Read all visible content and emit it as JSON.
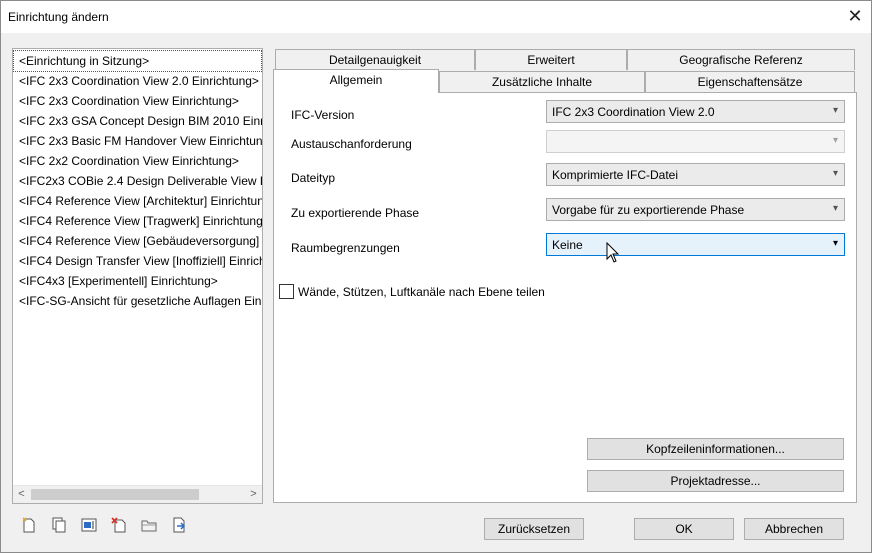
{
  "window": {
    "title": "Einrichtung ändern"
  },
  "setups": [
    "<Einrichtung in Sitzung>",
    "<IFC 2x3 Coordination View 2.0 Einrichtung>",
    "<IFC 2x3 Coordination View Einrichtung>",
    "<IFC 2x3 GSA Concept Design BIM 2010 Einric",
    "<IFC 2x3 Basic FM Handover View Einrichtung",
    "<IFC 2x2 Coordination View Einrichtung>",
    "<IFC2x3 COBie 2.4 Design Deliverable View Ei",
    "<IFC4 Reference View [Architektur] Einrichtun",
    "<IFC4 Reference View [Tragwerk] Einrichtung>",
    "<IFC4 Reference View [Gebäudeversorgung] E",
    "<IFC4 Design Transfer View [Inoffiziell] Einrich",
    "<IFC4x3 [Experimentell] Einrichtung>",
    "<IFC-SG-Ansicht für gesetzliche Auflagen Einr"
  ],
  "tabs": {
    "row1": [
      "Detailgenauigkeit",
      "Erweitert",
      "Geografische Referenz"
    ],
    "row2": [
      "Allgemein",
      "Zusätzliche Inhalte",
      "Eigenschaftensätze"
    ]
  },
  "general": {
    "ifc_version": {
      "label": "IFC-Version",
      "value": "IFC 2x3 Coordination View 2.0"
    },
    "exchange_requirement": {
      "label": "Austauschanforderung",
      "value": ""
    },
    "file_type": {
      "label": "Dateityp",
      "value": "Komprimierte IFC-Datei"
    },
    "phase": {
      "label": "Zu exportierende Phase",
      "value": "Vorgabe für zu exportierende Phase"
    },
    "space_boundaries": {
      "label": "Raumbegrenzungen",
      "value": "Keine"
    },
    "split_checkbox": {
      "label": "Wände, Stützen, Luftkanäle nach Ebene teilen",
      "checked": false
    },
    "header_button": "Kopfzeileninformationen...",
    "address_button": "Projektadresse..."
  },
  "footer": {
    "reset": "Zurücksetzen",
    "ok": "OK",
    "cancel": "Abbrechen"
  },
  "toolbar_icons": [
    "new-setup-icon",
    "duplicate-setup-icon",
    "rename-setup-icon",
    "delete-setup-icon",
    "import-setup-icon",
    "export-setup-icon"
  ],
  "colors": {
    "focus_blue": "#0078d7",
    "focus_fill": "#e5f1fb",
    "icon_red": "#d9342b",
    "icon_blue": "#2b6cc4"
  }
}
